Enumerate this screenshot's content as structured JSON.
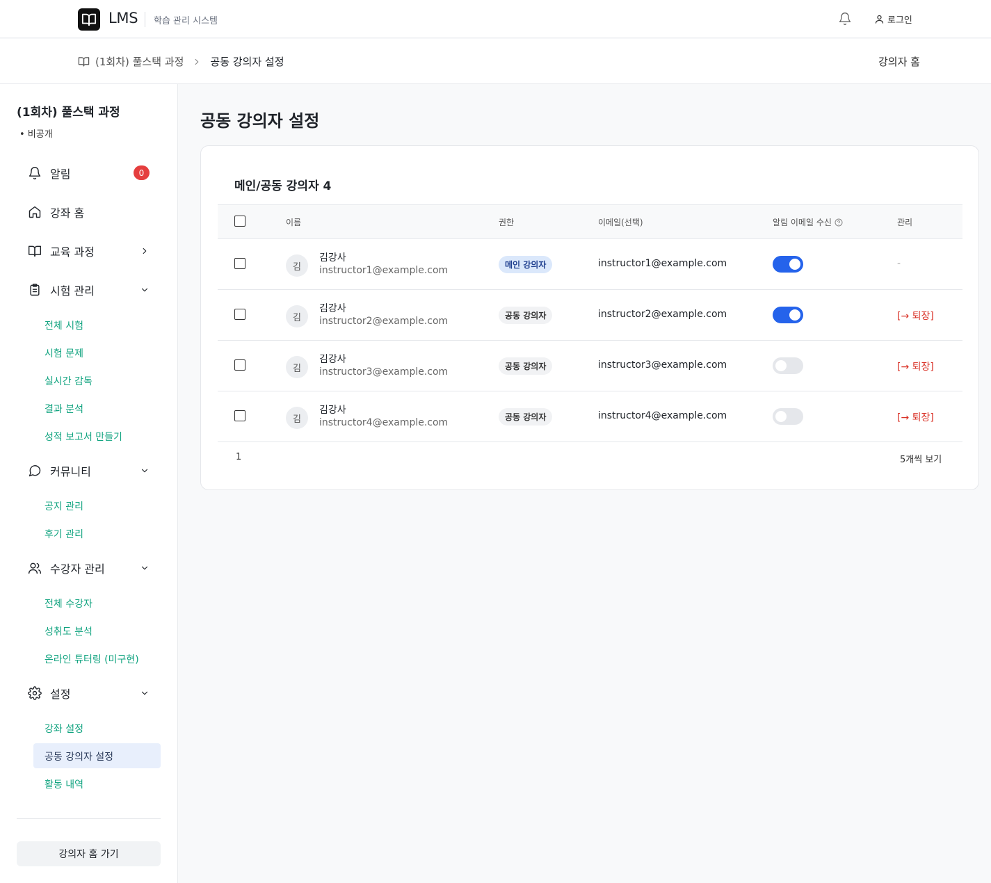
{
  "header": {
    "logo_text": "LMS",
    "subtitle": "학습 관리 시스템",
    "login_label": "로그인"
  },
  "breadcrumb": {
    "course": "(1회차) 풀스택 과정",
    "current": "공동 강의자 설정",
    "right_link": "강의자 홈"
  },
  "sidebar": {
    "course_title": "(1회차) 풀스택 과정",
    "course_status": "• 비공개",
    "notifications": {
      "label": "알림",
      "badge": "0"
    },
    "course_home": "강좌 홈",
    "curriculum": "교육 과정",
    "exam": {
      "label": "시험 관리",
      "items": [
        "전체 시험",
        "시험 문제",
        "실시간 감독",
        "결과 분석",
        "성적 보고서 만들기"
      ]
    },
    "community": {
      "label": "커뮤니티",
      "items": [
        "공지 관리",
        "후기 관리"
      ]
    },
    "students": {
      "label": "수강자 관리",
      "items": [
        "전체 수강자",
        "성취도 분석",
        "온라인 튜터링 (미구현)"
      ]
    },
    "settings": {
      "label": "설정",
      "items": [
        "강좌 설정",
        "공동 강의자 설정",
        "활동 내역"
      ],
      "active_index": 1
    },
    "home_button": "강의자 홈 가기"
  },
  "main": {
    "page_title": "공동 강의자 설정",
    "card_title": "메인/공동 강의자 4",
    "columns": {
      "name": "이름",
      "role": "권한",
      "email": "이메일(선택)",
      "notify": "알림 이메일 수신",
      "manage": "관리"
    },
    "rows": [
      {
        "avatar": "김",
        "name": "김강사",
        "account": "instructor1@example.com",
        "role": "메인 강의자",
        "role_type": "main",
        "email": "instructor1@example.com",
        "notify": true,
        "manage": "-"
      },
      {
        "avatar": "김",
        "name": "김강사",
        "account": "instructor2@example.com",
        "role": "공동 강의자",
        "role_type": "co",
        "email": "instructor2@example.com",
        "notify": true,
        "manage": "[→ 퇴장]"
      },
      {
        "avatar": "김",
        "name": "김강사",
        "account": "instructor3@example.com",
        "role": "공동 강의자",
        "role_type": "co",
        "email": "instructor3@example.com",
        "notify": false,
        "manage": "[→ 퇴장]"
      },
      {
        "avatar": "김",
        "name": "김강사",
        "account": "instructor4@example.com",
        "role": "공동 강의자",
        "role_type": "co",
        "email": "instructor4@example.com",
        "notify": false,
        "manage": "[→ 퇴장]"
      }
    ],
    "pagination": {
      "page": "1",
      "per_page": "5개씩 보기"
    }
  },
  "colors": {
    "accent_green": "#10a37f",
    "toggle_on": "#2563eb",
    "danger": "#d93025",
    "badge_red": "#e53e3e"
  },
  "icons": [
    "book-icon",
    "bell-icon",
    "user-icon",
    "home-icon",
    "clipboard-icon",
    "chat-icon",
    "users-icon",
    "gear-icon",
    "chevron-right-icon",
    "chevron-down-icon",
    "help-circle-icon"
  ]
}
